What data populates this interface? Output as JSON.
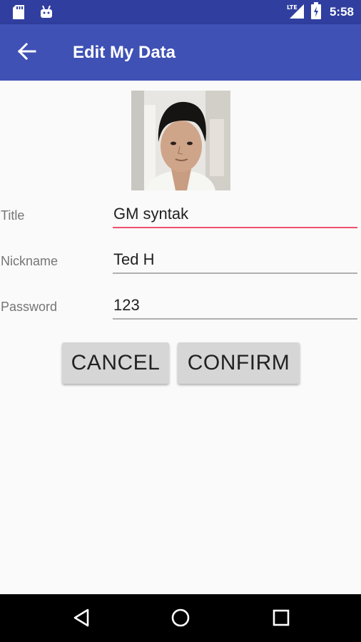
{
  "status_bar": {
    "time": "5:58",
    "network_label": "LTE",
    "icons": [
      "sd-card-icon",
      "android-icon",
      "signal-icon",
      "battery-charging-icon"
    ]
  },
  "app_bar": {
    "title": "Edit My Data",
    "back_icon": "arrow-back-icon"
  },
  "profile": {
    "photo_alt": "profile photo"
  },
  "form": {
    "title": {
      "label": "Title",
      "value": "GM syntak"
    },
    "nickname": {
      "label": "Nickname",
      "value": "Ted H"
    },
    "password": {
      "label": "Password",
      "value": "123"
    }
  },
  "buttons": {
    "cancel": "CANCEL",
    "confirm": "CONFIRM"
  },
  "nav_bar": {
    "icons": [
      "back-triangle-icon",
      "home-circle-icon",
      "recents-square-icon"
    ]
  },
  "colors": {
    "status_bar": "#303f9f",
    "app_bar": "#3f51b5",
    "focus_underline": "#f0506e",
    "button_bg": "#d6d6d6"
  }
}
